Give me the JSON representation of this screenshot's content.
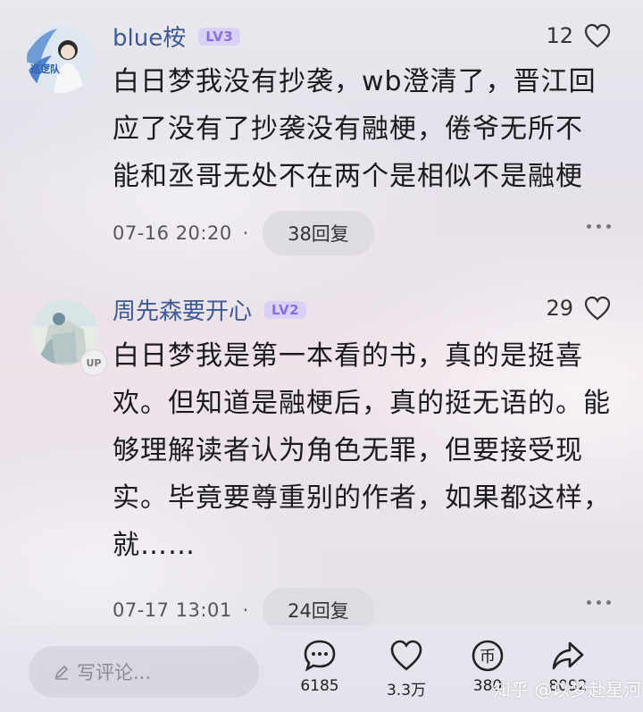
{
  "comments": [
    {
      "username": "blue桉",
      "level": "LV3",
      "likes": "12",
      "avatar_badge": "巡逻队",
      "lines": [
        "白日梦我没有抄袭，wb澄清了，晋江回",
        "应了没有了抄袭没有融梗，倦爷无所不",
        "能和丞哥无处不在两个是相似不是融梗"
      ],
      "time": "07-16 20:20",
      "reply_label": "38回复"
    },
    {
      "username": "周先森要开心",
      "level": "LV2",
      "likes": "29",
      "up_badge": "UP",
      "lines": [
        "白日梦我是第一本看的书，真的是挺喜",
        "欢。但知道是融梗后，真的挺无语的。能",
        "够理解读者认为角色无罪，但要接受现",
        "实。毕竟要尊重别的作者，如果都这样，",
        "就……"
      ],
      "time": "07-17 13:01",
      "reply_label": "24回复"
    }
  ],
  "bottom_bar": {
    "write_placeholder": "写评论...",
    "comments_count": "6185",
    "likes_count": "3.3万",
    "coins_count": "380",
    "shares_count": "8092",
    "coin_glyph": "币"
  },
  "watermark": "知乎 @以梦赴星河",
  "colors": {
    "username": "#3e5a96",
    "level_text": "#8a6fe0",
    "level_bg": "#d9d0f6"
  }
}
